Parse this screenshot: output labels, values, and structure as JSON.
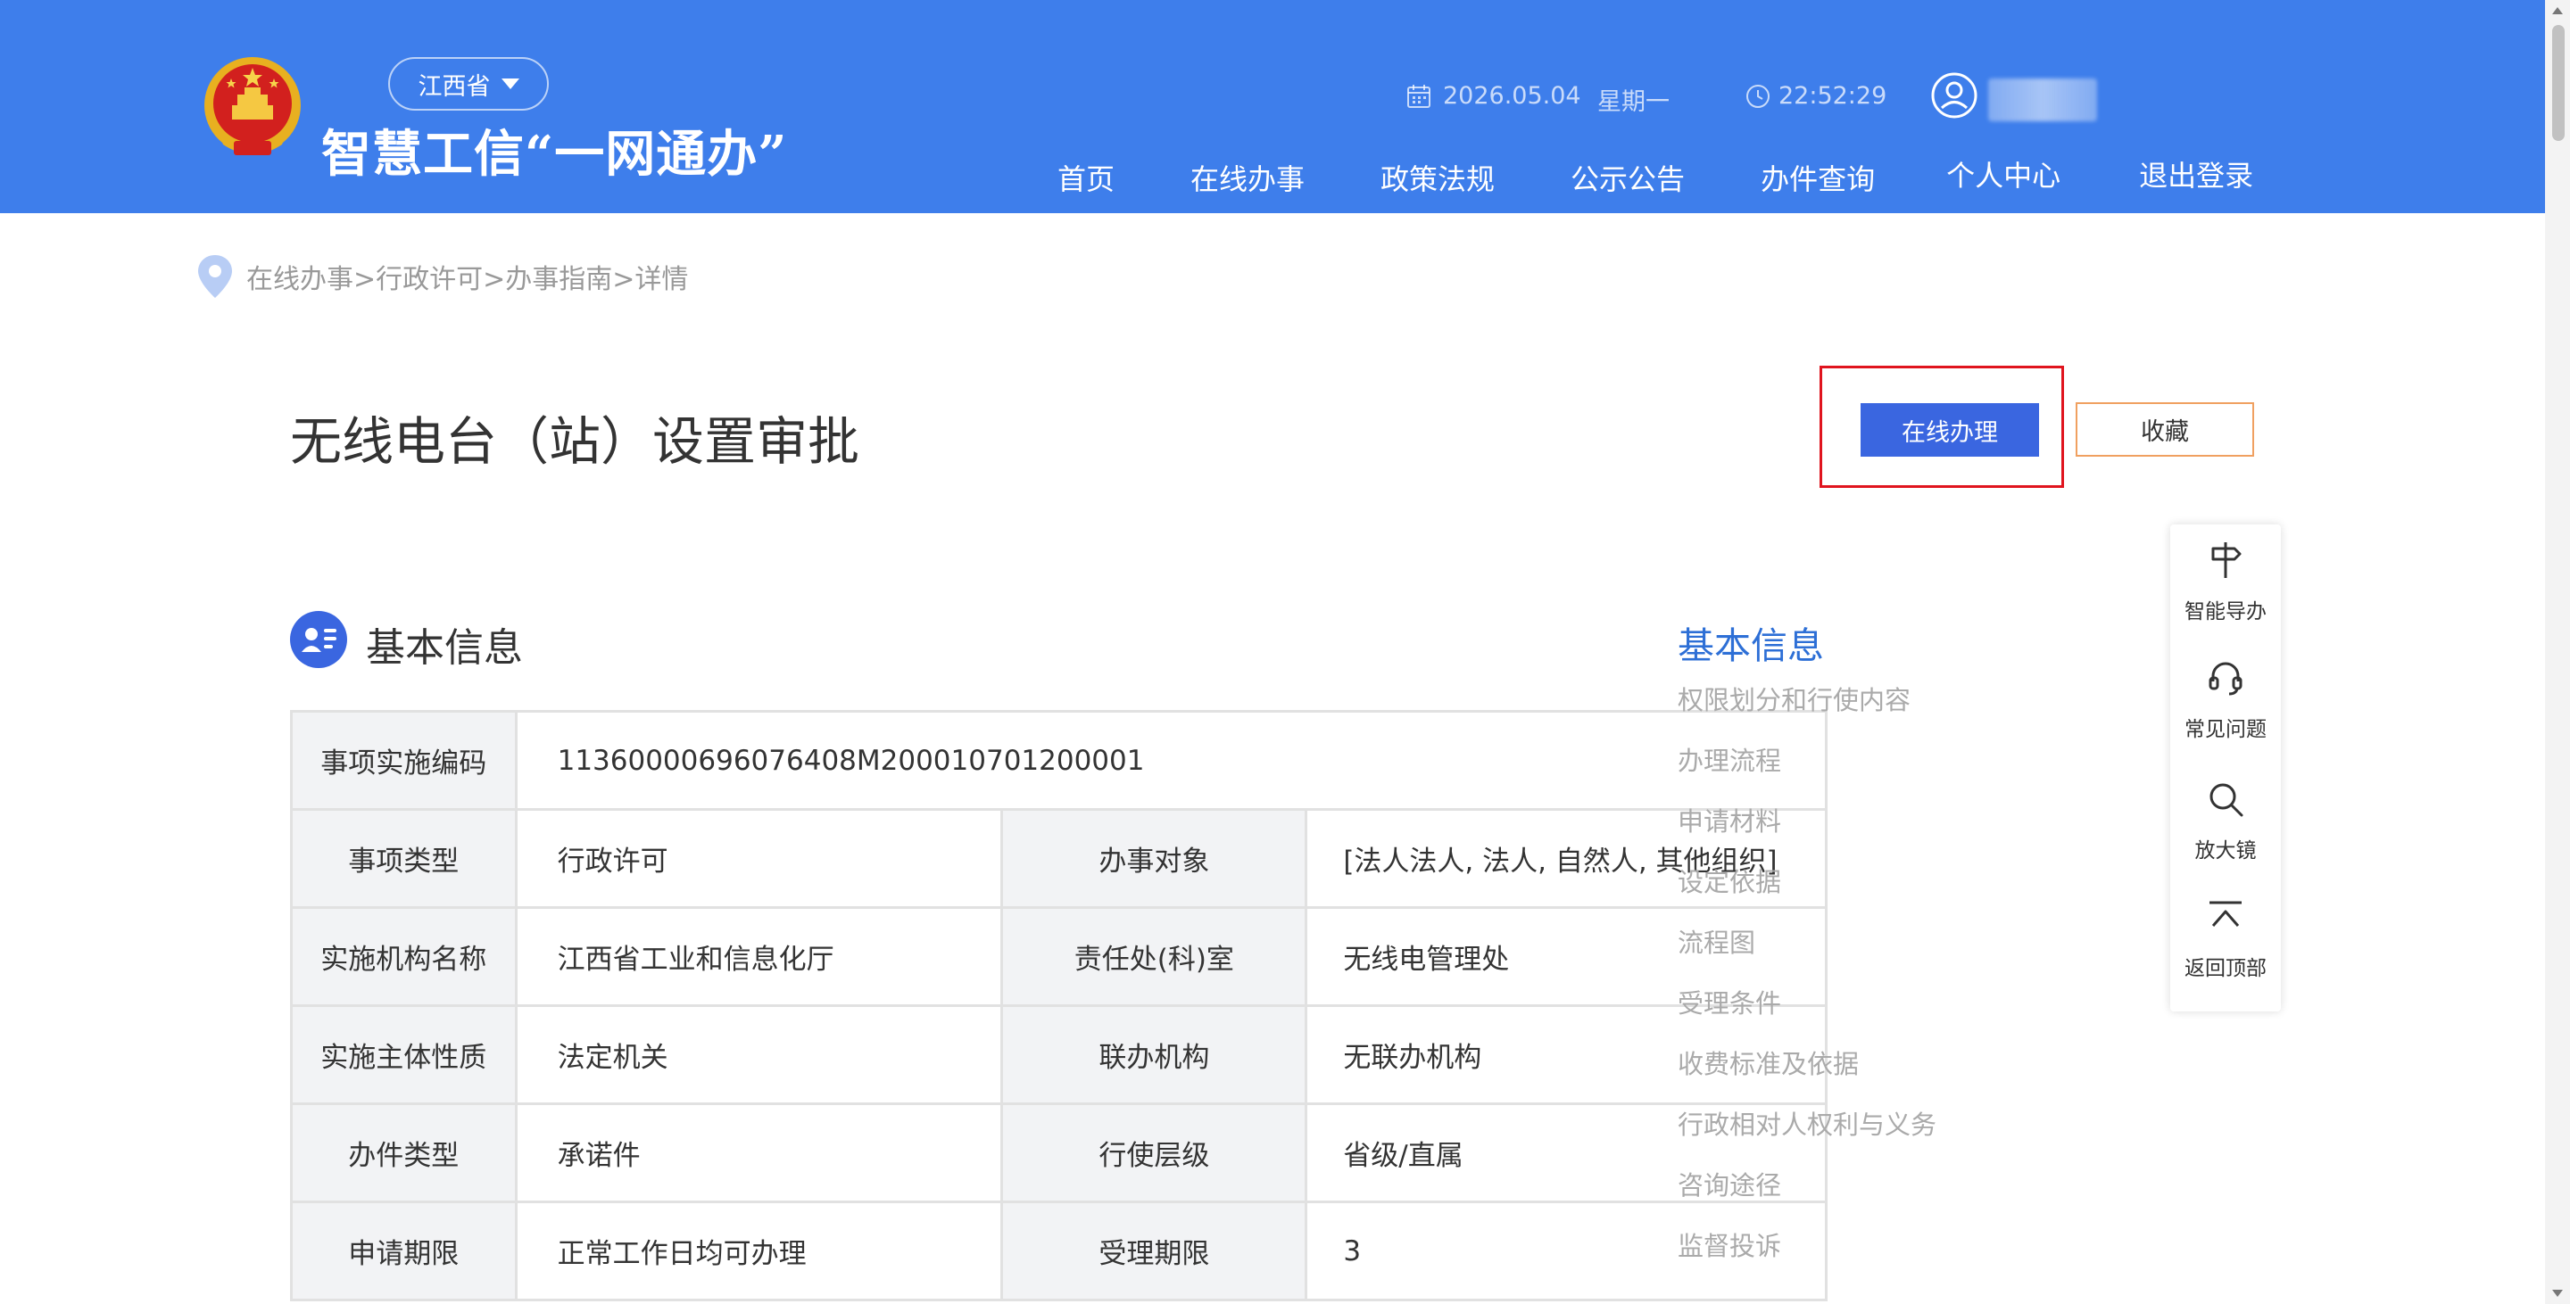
{
  "header": {
    "region": "江西省",
    "site_title": "智慧工信“一网通办”",
    "date": "2026.05.04",
    "weekday": "星期一",
    "time": "22:52:29",
    "nav": [
      "首页",
      "在线办事",
      "政策法规",
      "公示公告",
      "办件查询",
      "个人中心",
      "退出登录"
    ]
  },
  "breadcrumb": "在线办事>行政许可>办事指南>详情",
  "page": {
    "title": "无线电台（站）设置审批",
    "btn_online": "在线办理",
    "btn_favorite": "收藏"
  },
  "section": {
    "title": "基本信息"
  },
  "info_table": {
    "code_label": "事项实施编码",
    "code_value": "11360000696076408M200010701200001",
    "rows": [
      [
        "事项类型",
        "行政许可",
        "办事对象",
        "[法人法人, 法人, 自然人, 其他组织]"
      ],
      [
        "实施机构名称",
        "江西省工业和信息化厅",
        "责任处(科)室",
        "无线电管理处"
      ],
      [
        "实施主体性质",
        "法定机关",
        "联办机构",
        "无联办机构"
      ],
      [
        "办件类型",
        "承诺件",
        "行使层级",
        "省级/直属"
      ],
      [
        "申请期限",
        "正常工作日均可办理",
        "受理期限",
        "3"
      ]
    ]
  },
  "anchor_nav": {
    "heading": "基本信息",
    "items": [
      "权限划分和行使内容",
      "办理流程",
      "申请材料",
      "设定依据",
      "流程图",
      "受理条件",
      "收费标准及依据",
      "行政相对人权利与义务",
      "咨询途径",
      "监督投诉"
    ]
  },
  "side_tools": [
    {
      "label": "智能导办",
      "icon": "signpost-icon"
    },
    {
      "label": "常见问题",
      "icon": "headset-icon"
    },
    {
      "label": "放大镜",
      "icon": "magnifier-icon"
    },
    {
      "label": "返回顶部",
      "icon": "back-to-top-icon"
    }
  ],
  "colors": {
    "header_bg": "#3e7eeb",
    "primary_button": "#3a66e0",
    "anchor_active": "#2d6fd6",
    "highlight_border": "#e0141e",
    "favorite_border": "#f0a060"
  }
}
